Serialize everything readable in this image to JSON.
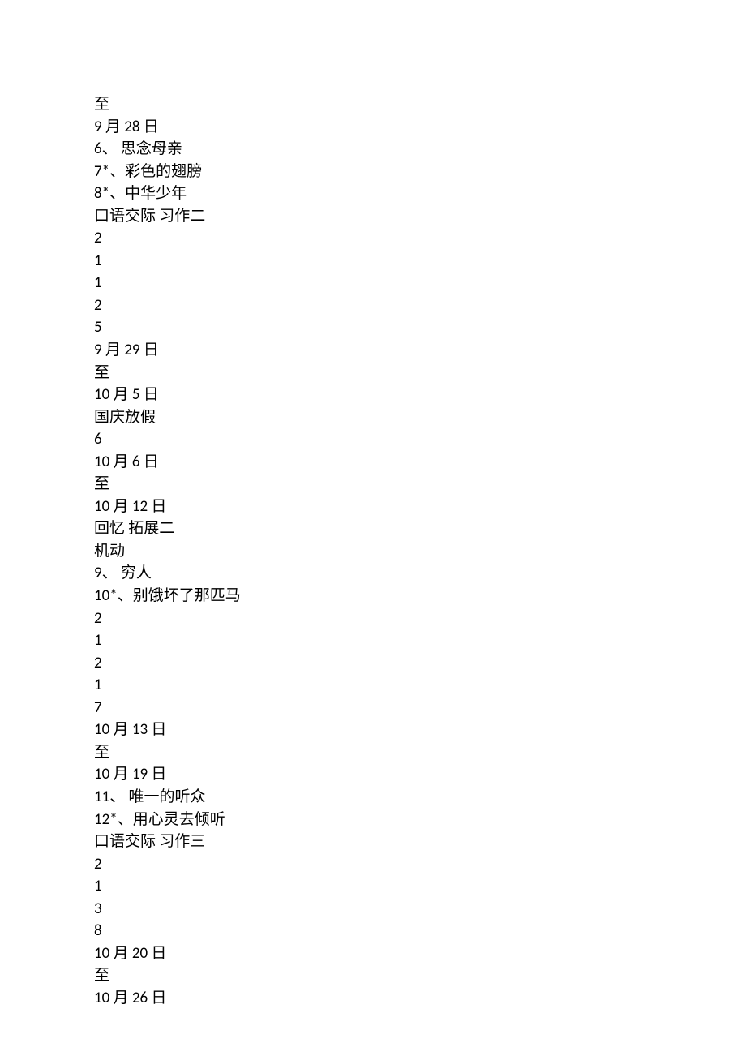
{
  "lines": [
    "至",
    "9 月 28 日",
    "6、 思念母亲",
    "7*、彩色的翅膀",
    "8*、中华少年",
    "口语交际 习作二",
    "2",
    "1",
    "1",
    "2",
    "5",
    "9 月 29 日",
    "至",
    "10 月 5 日",
    "国庆放假",
    "6",
    "10 月 6 日",
    "至",
    "10 月 12 日",
    "回忆 拓展二",
    "机动",
    "9、 穷人",
    "10*、别饿坏了那匹马",
    "2",
    "1",
    "2",
    "1",
    "7",
    "10 月 13 日",
    "至",
    "10 月 19 日",
    "11、 唯一的听众",
    "12*、用心灵去倾听",
    "口语交际 习作三",
    "2",
    "1",
    "3",
    "8",
    "10 月 20 日",
    "至",
    "10 月 26 日"
  ]
}
